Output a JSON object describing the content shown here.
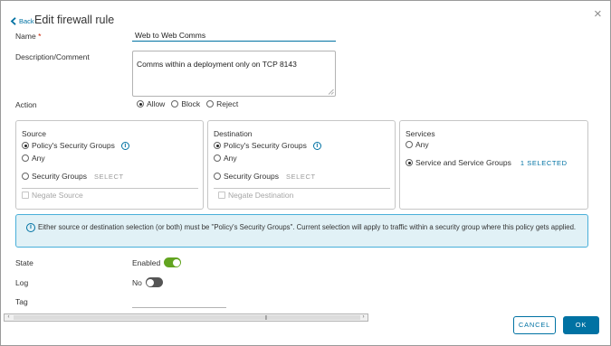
{
  "header": {
    "back_label": "Back",
    "title": "Edit firewall rule"
  },
  "form": {
    "name_label": "Name",
    "name_required_mark": "*",
    "name_value": "Web to Web Comms",
    "description_label": "Description/Comment",
    "description_value": "Comms within a deployment only on TCP 8143",
    "action_label": "Action",
    "action_options": [
      "Allow",
      "Block",
      "Reject"
    ],
    "action_selected": "Allow"
  },
  "source": {
    "title": "Source",
    "option_policy_groups": "Policy's Security Groups",
    "option_any": "Any",
    "option_security_groups": "Security Groups",
    "select_link": "SELECT",
    "negate_label": "Negate Source",
    "selected": "Policy's Security Groups"
  },
  "destination": {
    "title": "Destination",
    "option_policy_groups": "Policy's Security Groups",
    "option_any": "Any",
    "option_security_groups": "Security Groups",
    "select_link": "SELECT",
    "negate_label": "Negate Destination",
    "selected": "Policy's Security Groups"
  },
  "services": {
    "title": "Services",
    "option_any": "Any",
    "option_service_groups": "Service and Service Groups",
    "selected_link": "1 SELECTED",
    "selected": "Service and Service Groups"
  },
  "alert": {
    "text": "Either source or destination selection (or both) must be \"Policy's Security Groups\". Current selection will apply to traffic within a security group where this policy gets applied."
  },
  "settings": {
    "state_label": "State",
    "state_value": "Enabled",
    "state_on": true,
    "log_label": "Log",
    "log_value": "No",
    "log_on": false,
    "tag_label": "Tag"
  },
  "footer": {
    "cancel_label": "CANCEL",
    "ok_label": "OK"
  },
  "colors": {
    "accent": "#0072a3",
    "toggle_on": "#62a420",
    "alert_bg": "#e1f1f6",
    "alert_border": "#49afd9",
    "required": "#c92100"
  },
  "icons": [
    "chevron-left-icon",
    "close-icon",
    "info-icon",
    "resize-grip-icon",
    "scroll-left-icon",
    "scroll-right-icon"
  ]
}
